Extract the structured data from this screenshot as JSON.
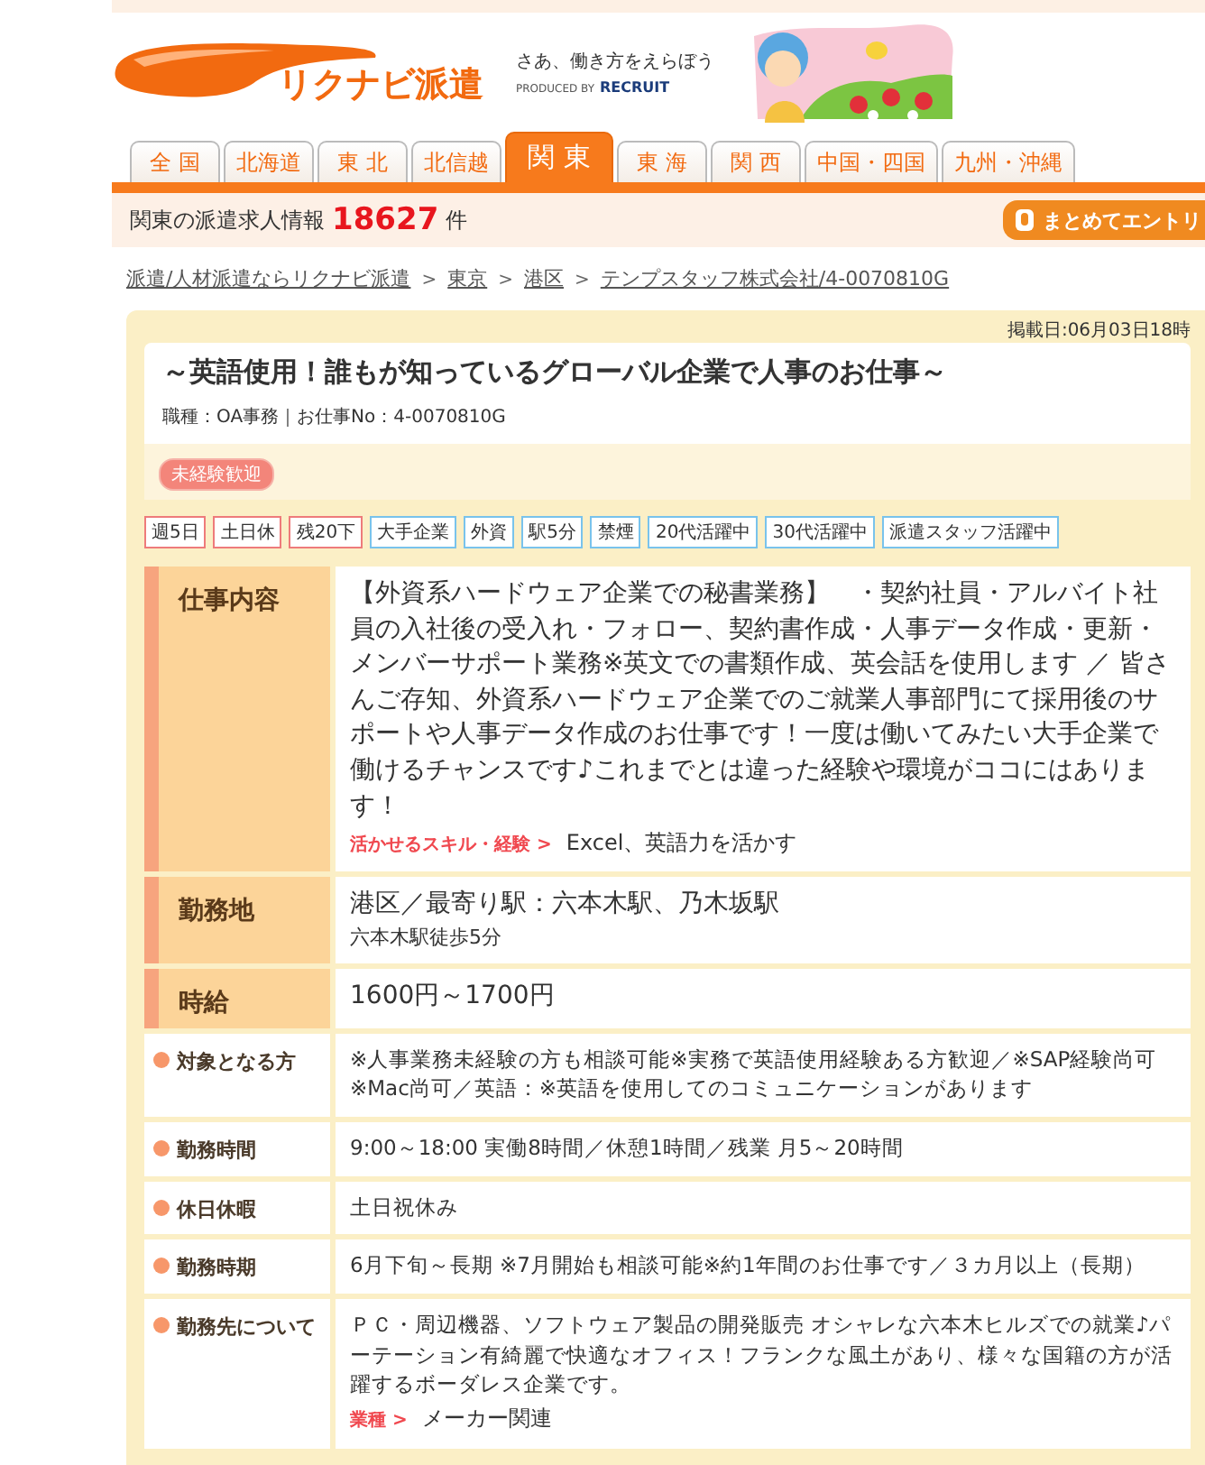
{
  "header": {
    "logo_text": "リクナビ派遣",
    "tagline": "さあ、働き方をえらぼう",
    "produced_by": "PRODUCED BY",
    "brand": "RECRUIT"
  },
  "region_tabs": [
    {
      "label": "全 国",
      "selected": false
    },
    {
      "label": "北海道",
      "selected": false
    },
    {
      "label": "東 北",
      "selected": false
    },
    {
      "label": "北信越",
      "selected": false
    },
    {
      "label": "関 東",
      "selected": true
    },
    {
      "label": "東 海",
      "selected": false
    },
    {
      "label": "関 西",
      "selected": false
    },
    {
      "label": "中国・四国",
      "selected": false
    },
    {
      "label": "九州・沖縄",
      "selected": false
    }
  ],
  "info_bar": {
    "prefix": "関東の派遣求人情報",
    "count": "18627",
    "suffix": "件",
    "entry_button": "まとめてエントリ"
  },
  "breadcrumb": {
    "separator": ">",
    "items": [
      "派遣/人材派遣ならリクナビ派遣",
      "東京",
      "港区",
      "テンプスタッフ株式会社/4-0070810G"
    ]
  },
  "posting": {
    "date": "掲載日:06月03日18時",
    "title": "～英語使用！誰もが知っているグローバル企業で人事のお仕事～",
    "meta": "職種：OA事務｜お仕事No：4-0070810G",
    "badge": "未経験歓迎",
    "tags": [
      {
        "label": "週5日",
        "color": "#ee7b7b"
      },
      {
        "label": "土日休",
        "color": "#ee7b7b"
      },
      {
        "label": "残20下",
        "color": "#ee7b7b"
      },
      {
        "label": "大手企業",
        "color": "#79c3ec"
      },
      {
        "label": "外資",
        "color": "#79c3ec"
      },
      {
        "label": "駅5分",
        "color": "#79c3ec"
      },
      {
        "label": "禁煙",
        "color": "#79c3ec"
      },
      {
        "label": "20代活躍中",
        "color": "#79c3ec"
      },
      {
        "label": "30代活躍中",
        "color": "#79c3ec"
      },
      {
        "label": "派遣スタッフ活躍中",
        "color": "#79c3ec"
      }
    ],
    "details": [
      {
        "kind": "main",
        "label": "仕事内容",
        "text": "【外資系ハードウェア企業での秘書業務】　・契約社員・アルバイト社員の入社後の受入れ・フォロー、契約書作成・人事データ作成・更新・メンバーサポート業務※英文での書類作成、英会話を使用します ／ 皆さんご存知、外資系ハードウェア企業でのご就業人事部門にて採用後のサポートや人事データ作成のお仕事です！一度は働いてみたい大手企業で働けるチャンスです♪これまでとは違った経験や環境がココにはあります！",
        "note_label": "活かせるスキル・経験 >",
        "note": "Excel、英語力を活かす"
      },
      {
        "kind": "main",
        "label": "勤務地",
        "text": "港区／最寄り駅：六本木駅、乃木坂駅",
        "sub": "六本木駅徒歩5分"
      },
      {
        "kind": "main",
        "label": "時給",
        "text": "1600円～1700円"
      },
      {
        "kind": "sub",
        "label": "対象となる方",
        "text": "※人事業務未経験の方も相談可能※実務で英語使用経験ある方歓迎／※SAP経験尚可※Mac尚可／英語：※英語を使用してのコミュニケーションがあります"
      },
      {
        "kind": "sub",
        "label": "勤務時間",
        "text": "9:00～18:00 実働8時間／休憩1時間／残業 月5～20時間"
      },
      {
        "kind": "sub",
        "label": "休日休暇",
        "text": "土日祝休み"
      },
      {
        "kind": "sub",
        "label": "勤務時期",
        "text": "6月下旬～長期 ※7月開始も相談可能※約1年間のお仕事です／３カ月以上（長期）"
      },
      {
        "kind": "sub",
        "label": "勤務先について",
        "text": "ＰＣ・周辺機器、ソフトウェア製品の開発販売 オシャレな六本木ヒルズでの就業♪パーテーション有綺麗で快適なオフィス！フランクな風土があり、様々な国籍の方が活躍するボーダレス企業です。",
        "note_label": "業種 >",
        "note": "メーカー関連"
      }
    ]
  }
}
